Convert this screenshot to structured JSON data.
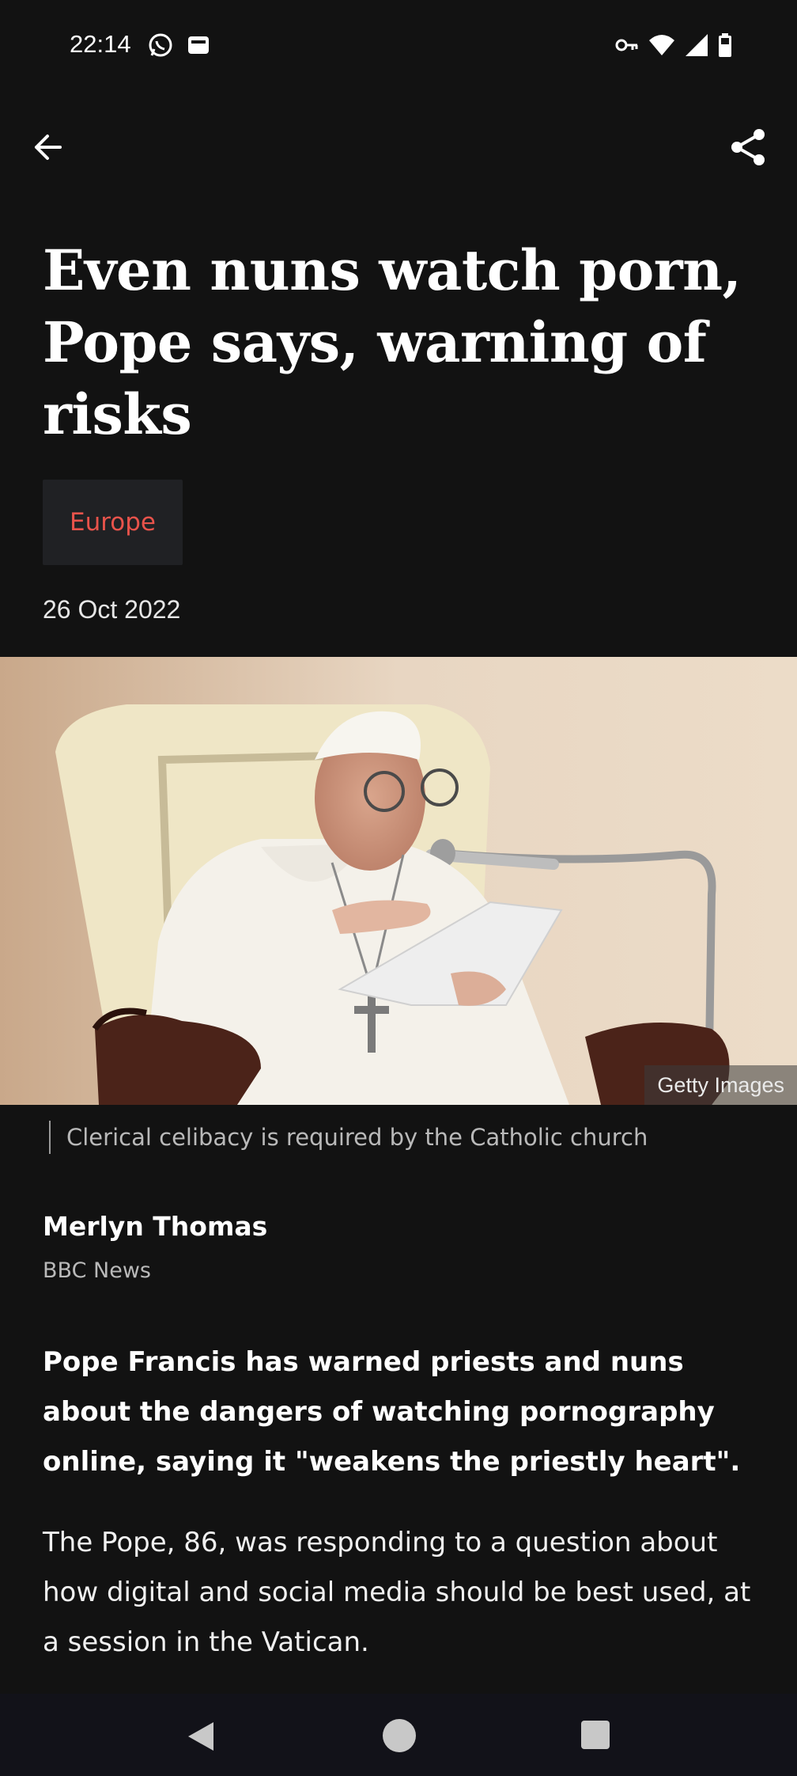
{
  "status_bar": {
    "time": "22:14",
    "left_icons": [
      "whatsapp-icon",
      "inbox-icon"
    ],
    "right_icons": [
      "vpn-key-icon",
      "wifi-icon",
      "signal-icon",
      "battery-icon"
    ]
  },
  "app_bar": {
    "back_icon": "arrow-left-icon",
    "share_icon": "share-icon"
  },
  "article": {
    "headline": "Even nuns watch porn, Pope says, warning of risks",
    "topic": "Europe",
    "date": "26 Oct 2022",
    "image": {
      "credit": "Getty Images",
      "caption": "Clerical celibacy is required by the Catholic church"
    },
    "author": {
      "name": "Merlyn Thomas",
      "org": "BBC News"
    },
    "lede": "Pope Francis has warned priests and nuns about the dangers of watching pornography online, saying it \"weakens the priestly heart\".",
    "paragraph_1": "The Pope, 86, was responding to a question about how digital and social media should be best used, at a session in the Vatican."
  },
  "nav_bar": {
    "icons": [
      "nav-back-icon",
      "nav-home-icon",
      "nav-recents-icon"
    ]
  },
  "colors": {
    "background": "#121212",
    "topic_accent": "#e8534b",
    "chip_background": "#202124"
  }
}
